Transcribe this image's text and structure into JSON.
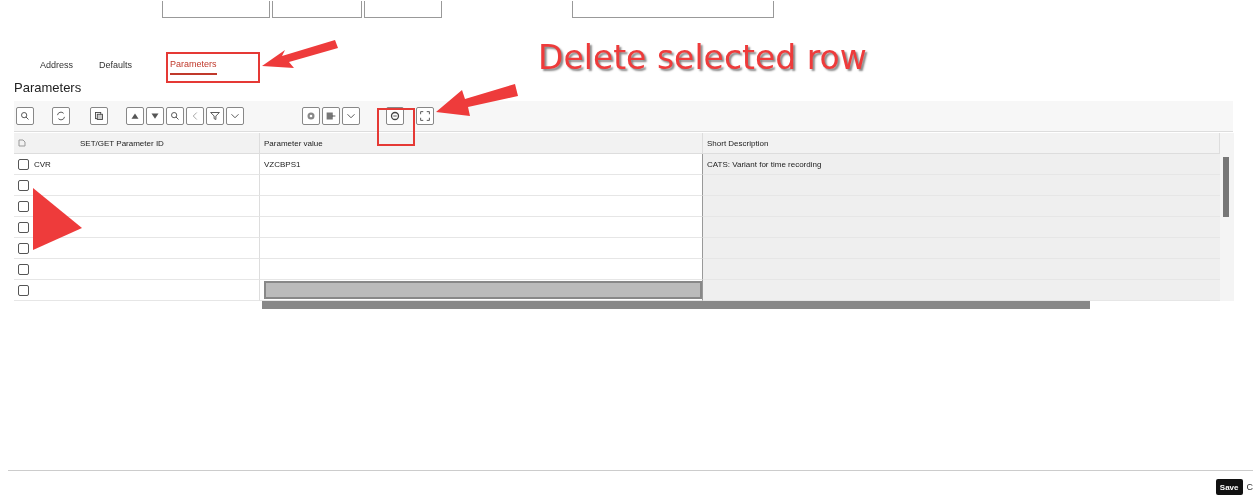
{
  "tabs": [
    {
      "label": "Address",
      "selected": false
    },
    {
      "label": "Defaults",
      "selected": false
    },
    {
      "label": "Parameters",
      "selected": true
    }
  ],
  "section_title": "Parameters",
  "toolbar": [
    {
      "kind": "zoom"
    },
    {
      "kind": "sep"
    },
    {
      "kind": "refresh"
    },
    {
      "kind": "sep"
    },
    {
      "kind": "copy"
    },
    {
      "kind": "sep"
    },
    {
      "kind": "sort-up"
    },
    {
      "kind": "sort-down"
    },
    {
      "kind": "find"
    },
    {
      "kind": "prev"
    },
    {
      "kind": "filter"
    },
    {
      "kind": "dropdown"
    },
    {
      "kind": "sep"
    },
    {
      "kind": "settings"
    },
    {
      "kind": "export"
    },
    {
      "kind": "dropdown"
    },
    {
      "kind": "sep"
    },
    {
      "kind": "delete"
    },
    {
      "kind": "sep"
    },
    {
      "kind": "fullscreen"
    }
  ],
  "table": {
    "columns": [
      "SET/GET Parameter ID",
      "Parameter value",
      "Short Description"
    ],
    "rows": [
      {
        "checked": false,
        "parameter_id": "CVR",
        "parameter_value": "VZCBPS1",
        "short_description": "CATS: Variant for time recording"
      },
      {
        "checked": false
      },
      {
        "checked": false
      },
      {
        "checked": false
      },
      {
        "checked": false
      },
      {
        "checked": false
      },
      {
        "checked": false
      }
    ]
  },
  "annotation": {
    "text": "Delete selected row"
  },
  "footer": {
    "buttons": [
      {
        "label": "Save",
        "kind": "primary"
      },
      {
        "label": "C",
        "kind": "plain"
      }
    ]
  }
}
